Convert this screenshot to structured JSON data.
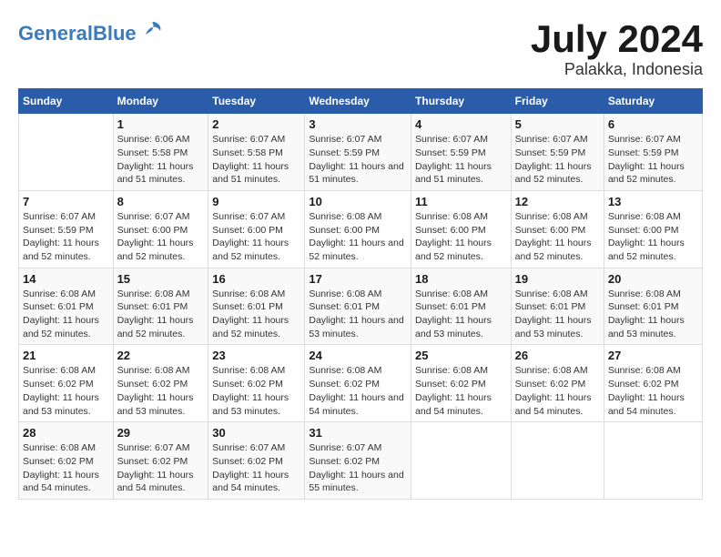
{
  "header": {
    "logo_line1": "General",
    "logo_line2": "Blue",
    "main_title": "July 2024",
    "subtitle": "Palakka, Indonesia"
  },
  "weekdays": [
    "Sunday",
    "Monday",
    "Tuesday",
    "Wednesday",
    "Thursday",
    "Friday",
    "Saturday"
  ],
  "weeks": [
    [
      {
        "day": "",
        "sunrise": "",
        "sunset": "",
        "daylight": ""
      },
      {
        "day": "1",
        "sunrise": "Sunrise: 6:06 AM",
        "sunset": "Sunset: 5:58 PM",
        "daylight": "Daylight: 11 hours and 51 minutes."
      },
      {
        "day": "2",
        "sunrise": "Sunrise: 6:07 AM",
        "sunset": "Sunset: 5:58 PM",
        "daylight": "Daylight: 11 hours and 51 minutes."
      },
      {
        "day": "3",
        "sunrise": "Sunrise: 6:07 AM",
        "sunset": "Sunset: 5:59 PM",
        "daylight": "Daylight: 11 hours and 51 minutes."
      },
      {
        "day": "4",
        "sunrise": "Sunrise: 6:07 AM",
        "sunset": "Sunset: 5:59 PM",
        "daylight": "Daylight: 11 hours and 51 minutes."
      },
      {
        "day": "5",
        "sunrise": "Sunrise: 6:07 AM",
        "sunset": "Sunset: 5:59 PM",
        "daylight": "Daylight: 11 hours and 52 minutes."
      },
      {
        "day": "6",
        "sunrise": "Sunrise: 6:07 AM",
        "sunset": "Sunset: 5:59 PM",
        "daylight": "Daylight: 11 hours and 52 minutes."
      }
    ],
    [
      {
        "day": "7",
        "sunrise": "Sunrise: 6:07 AM",
        "sunset": "Sunset: 5:59 PM",
        "daylight": "Daylight: 11 hours and 52 minutes."
      },
      {
        "day": "8",
        "sunrise": "Sunrise: 6:07 AM",
        "sunset": "Sunset: 6:00 PM",
        "daylight": "Daylight: 11 hours and 52 minutes."
      },
      {
        "day": "9",
        "sunrise": "Sunrise: 6:07 AM",
        "sunset": "Sunset: 6:00 PM",
        "daylight": "Daylight: 11 hours and 52 minutes."
      },
      {
        "day": "10",
        "sunrise": "Sunrise: 6:08 AM",
        "sunset": "Sunset: 6:00 PM",
        "daylight": "Daylight: 11 hours and 52 minutes."
      },
      {
        "day": "11",
        "sunrise": "Sunrise: 6:08 AM",
        "sunset": "Sunset: 6:00 PM",
        "daylight": "Daylight: 11 hours and 52 minutes."
      },
      {
        "day": "12",
        "sunrise": "Sunrise: 6:08 AM",
        "sunset": "Sunset: 6:00 PM",
        "daylight": "Daylight: 11 hours and 52 minutes."
      },
      {
        "day": "13",
        "sunrise": "Sunrise: 6:08 AM",
        "sunset": "Sunset: 6:00 PM",
        "daylight": "Daylight: 11 hours and 52 minutes."
      }
    ],
    [
      {
        "day": "14",
        "sunrise": "Sunrise: 6:08 AM",
        "sunset": "Sunset: 6:01 PM",
        "daylight": "Daylight: 11 hours and 52 minutes."
      },
      {
        "day": "15",
        "sunrise": "Sunrise: 6:08 AM",
        "sunset": "Sunset: 6:01 PM",
        "daylight": "Daylight: 11 hours and 52 minutes."
      },
      {
        "day": "16",
        "sunrise": "Sunrise: 6:08 AM",
        "sunset": "Sunset: 6:01 PM",
        "daylight": "Daylight: 11 hours and 52 minutes."
      },
      {
        "day": "17",
        "sunrise": "Sunrise: 6:08 AM",
        "sunset": "Sunset: 6:01 PM",
        "daylight": "Daylight: 11 hours and 53 minutes."
      },
      {
        "day": "18",
        "sunrise": "Sunrise: 6:08 AM",
        "sunset": "Sunset: 6:01 PM",
        "daylight": "Daylight: 11 hours and 53 minutes."
      },
      {
        "day": "19",
        "sunrise": "Sunrise: 6:08 AM",
        "sunset": "Sunset: 6:01 PM",
        "daylight": "Daylight: 11 hours and 53 minutes."
      },
      {
        "day": "20",
        "sunrise": "Sunrise: 6:08 AM",
        "sunset": "Sunset: 6:01 PM",
        "daylight": "Daylight: 11 hours and 53 minutes."
      }
    ],
    [
      {
        "day": "21",
        "sunrise": "Sunrise: 6:08 AM",
        "sunset": "Sunset: 6:02 PM",
        "daylight": "Daylight: 11 hours and 53 minutes."
      },
      {
        "day": "22",
        "sunrise": "Sunrise: 6:08 AM",
        "sunset": "Sunset: 6:02 PM",
        "daylight": "Daylight: 11 hours and 53 minutes."
      },
      {
        "day": "23",
        "sunrise": "Sunrise: 6:08 AM",
        "sunset": "Sunset: 6:02 PM",
        "daylight": "Daylight: 11 hours and 53 minutes."
      },
      {
        "day": "24",
        "sunrise": "Sunrise: 6:08 AM",
        "sunset": "Sunset: 6:02 PM",
        "daylight": "Daylight: 11 hours and 54 minutes."
      },
      {
        "day": "25",
        "sunrise": "Sunrise: 6:08 AM",
        "sunset": "Sunset: 6:02 PM",
        "daylight": "Daylight: 11 hours and 54 minutes."
      },
      {
        "day": "26",
        "sunrise": "Sunrise: 6:08 AM",
        "sunset": "Sunset: 6:02 PM",
        "daylight": "Daylight: 11 hours and 54 minutes."
      },
      {
        "day": "27",
        "sunrise": "Sunrise: 6:08 AM",
        "sunset": "Sunset: 6:02 PM",
        "daylight": "Daylight: 11 hours and 54 minutes."
      }
    ],
    [
      {
        "day": "28",
        "sunrise": "Sunrise: 6:08 AM",
        "sunset": "Sunset: 6:02 PM",
        "daylight": "Daylight: 11 hours and 54 minutes."
      },
      {
        "day": "29",
        "sunrise": "Sunrise: 6:07 AM",
        "sunset": "Sunset: 6:02 PM",
        "daylight": "Daylight: 11 hours and 54 minutes."
      },
      {
        "day": "30",
        "sunrise": "Sunrise: 6:07 AM",
        "sunset": "Sunset: 6:02 PM",
        "daylight": "Daylight: 11 hours and 54 minutes."
      },
      {
        "day": "31",
        "sunrise": "Sunrise: 6:07 AM",
        "sunset": "Sunset: 6:02 PM",
        "daylight": "Daylight: 11 hours and 55 minutes."
      },
      {
        "day": "",
        "sunrise": "",
        "sunset": "",
        "daylight": ""
      },
      {
        "day": "",
        "sunrise": "",
        "sunset": "",
        "daylight": ""
      },
      {
        "day": "",
        "sunrise": "",
        "sunset": "",
        "daylight": ""
      }
    ]
  ]
}
